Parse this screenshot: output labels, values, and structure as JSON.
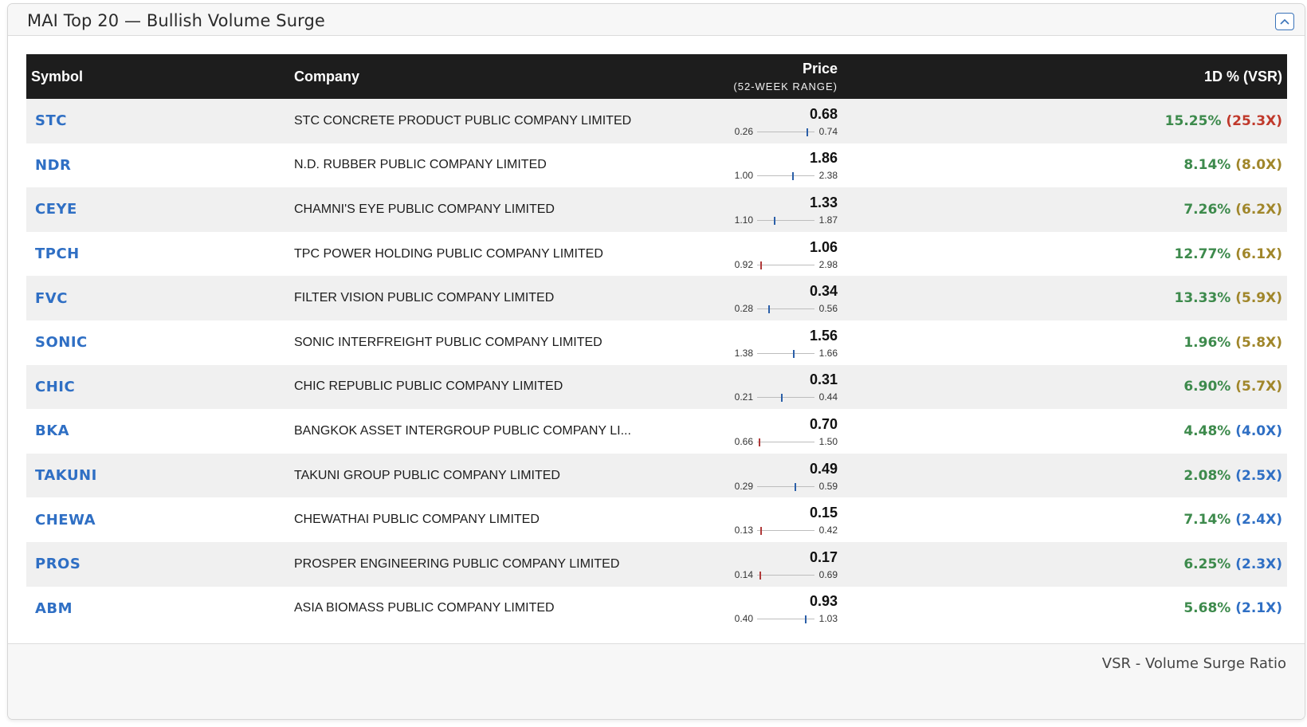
{
  "panel": {
    "title": "MAI Top 20 — Bullish Volume Surge",
    "footer_note": "VSR - Volume Surge Ratio"
  },
  "table": {
    "headers": {
      "symbol": "Symbol",
      "company": "Company",
      "price": "Price",
      "price_sub": "(52-WEEK RANGE)",
      "change": "1D % (VSR)"
    },
    "rows": [
      {
        "symbol": "STC",
        "company": "STC CONCRETE PRODUCT PUBLIC COMPANY LIMITED",
        "price": "0.68",
        "low": "0.26",
        "high": "0.74",
        "change": "15.25%",
        "vsr": "(25.3X)",
        "vsr_color": "#c0392b",
        "tick_color": "#2b5fa8"
      },
      {
        "symbol": "NDR",
        "company": "N.D. RUBBER PUBLIC COMPANY LIMITED",
        "price": "1.86",
        "low": "1.00",
        "high": "2.38",
        "change": "8.14%",
        "vsr": "(8.0X)",
        "vsr_color": "#a0862a",
        "tick_color": "#2b5fa8"
      },
      {
        "symbol": "CEYE",
        "company": "CHAMNI'S EYE PUBLIC COMPANY LIMITED",
        "price": "1.33",
        "low": "1.10",
        "high": "1.87",
        "change": "7.26%",
        "vsr": "(6.2X)",
        "vsr_color": "#a0862a",
        "tick_color": "#2b5fa8"
      },
      {
        "symbol": "TPCH",
        "company": "TPC POWER HOLDING PUBLIC COMPANY LIMITED",
        "price": "1.06",
        "low": "0.92",
        "high": "2.98",
        "change": "12.77%",
        "vsr": "(6.1X)",
        "vsr_color": "#a0862a",
        "tick_color": "#b03a3a"
      },
      {
        "symbol": "FVC",
        "company": "FILTER VISION PUBLIC COMPANY LIMITED",
        "price": "0.34",
        "low": "0.28",
        "high": "0.56",
        "change": "13.33%",
        "vsr": "(5.9X)",
        "vsr_color": "#a0862a",
        "tick_color": "#2b5fa8"
      },
      {
        "symbol": "SONIC",
        "company": "SONIC INTERFREIGHT PUBLIC COMPANY LIMITED",
        "price": "1.56",
        "low": "1.38",
        "high": "1.66",
        "change": "1.96%",
        "vsr": "(5.8X)",
        "vsr_color": "#a0862a",
        "tick_color": "#2b5fa8"
      },
      {
        "symbol": "CHIC",
        "company": "CHIC REPUBLIC PUBLIC COMPANY LIMITED",
        "price": "0.31",
        "low": "0.21",
        "high": "0.44",
        "change": "6.90%",
        "vsr": "(5.7X)",
        "vsr_color": "#a0862a",
        "tick_color": "#2b5fa8"
      },
      {
        "symbol": "BKA",
        "company": "BANGKOK ASSET INTERGROUP PUBLIC COMPANY LI...",
        "price": "0.70",
        "low": "0.66",
        "high": "1.50",
        "change": "4.48%",
        "vsr": "(4.0X)",
        "vsr_color": "#2f6fc4",
        "tick_color": "#b03a3a"
      },
      {
        "symbol": "TAKUNI",
        "company": "TAKUNI GROUP PUBLIC COMPANY LIMITED",
        "price": "0.49",
        "low": "0.29",
        "high": "0.59",
        "change": "2.08%",
        "vsr": "(2.5X)",
        "vsr_color": "#2f6fc4",
        "tick_color": "#2b5fa8"
      },
      {
        "symbol": "CHEWA",
        "company": "CHEWATHAI PUBLIC COMPANY LIMITED",
        "price": "0.15",
        "low": "0.13",
        "high": "0.42",
        "change": "7.14%",
        "vsr": "(2.4X)",
        "vsr_color": "#2f6fc4",
        "tick_color": "#b03a3a"
      },
      {
        "symbol": "PROS",
        "company": "PROSPER ENGINEERING PUBLIC COMPANY LIMITED",
        "price": "0.17",
        "low": "0.14",
        "high": "0.69",
        "change": "6.25%",
        "vsr": "(2.3X)",
        "vsr_color": "#2f6fc4",
        "tick_color": "#b03a3a"
      },
      {
        "symbol": "ABM",
        "company": "ASIA BIOMASS PUBLIC COMPANY LIMITED",
        "price": "0.93",
        "low": "0.40",
        "high": "1.03",
        "change": "5.68%",
        "vsr": "(2.1X)",
        "vsr_color": "#2f6fc4",
        "tick_color": "#2b5fa8"
      }
    ]
  },
  "colors": {
    "header_bg": "#1d1d1d",
    "symbol_link": "#2f6fc4",
    "gain": "#3d8a4c"
  },
  "icons": {
    "collapse": "chevron-up-icon"
  }
}
